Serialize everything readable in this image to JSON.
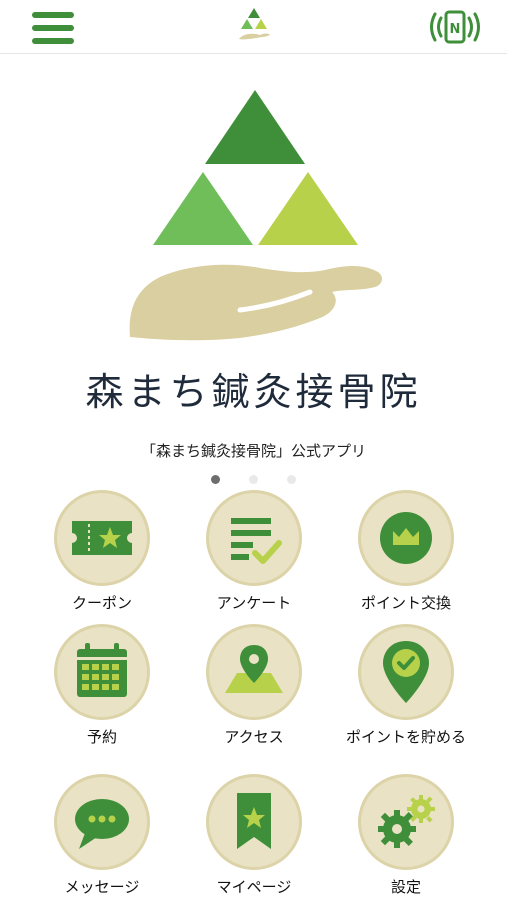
{
  "header": {
    "menu_icon": "hamburger-icon",
    "logo_icon": "clinic-logo-icon",
    "nfc_icon": "nfc-phone-icon"
  },
  "hero": {
    "clinic_name": "森まち鍼灸接骨院",
    "subtitle": "「森まち鍼灸接骨院」公式アプリ",
    "slides": 3,
    "active_slide": 1
  },
  "menu": [
    {
      "label": "クーポン",
      "icon": "coupon-ticket-icon"
    },
    {
      "label": "アンケート",
      "icon": "survey-checklist-icon"
    },
    {
      "label": "ポイント交換",
      "icon": "point-crown-icon"
    },
    {
      "label": "予約",
      "icon": "calendar-icon"
    },
    {
      "label": "アクセス",
      "icon": "map-pin-icon"
    },
    {
      "label": "ポイントを貯める",
      "icon": "location-check-icon"
    },
    {
      "label": "メッセージ",
      "icon": "chat-bubble-icon"
    },
    {
      "label": "マイページ",
      "icon": "bookmark-star-icon"
    },
    {
      "label": "設定",
      "icon": "gears-icon"
    }
  ],
  "colors": {
    "primary_green": "#3f8f3a",
    "light_green": "#6fbe5a",
    "lime": "#b7d24a",
    "beige": "#e9e2c4",
    "hand": "#d9cfa0"
  }
}
